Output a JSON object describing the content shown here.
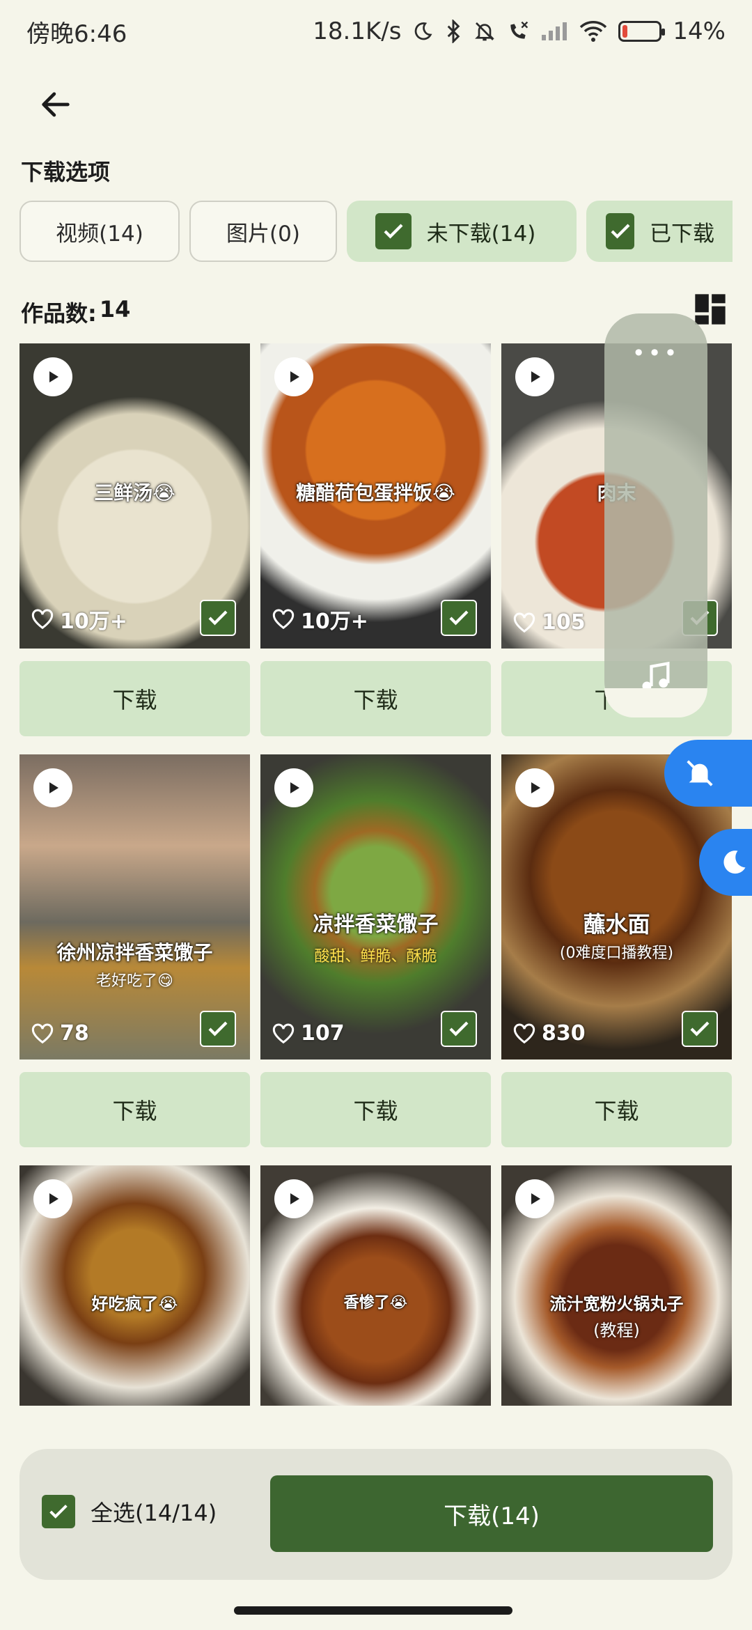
{
  "status": {
    "time": "傍晚6:46",
    "speed": "18.1K/s",
    "battery": "14%",
    "battery_level": 0.14
  },
  "header": {
    "section_title": "下载选项"
  },
  "chips": [
    {
      "label": "视频(14)",
      "checked": false
    },
    {
      "label": "图片(0)",
      "checked": false
    },
    {
      "label": "未下载(14)",
      "checked": true
    },
    {
      "label": "已下载",
      "checked": true
    }
  ],
  "count": {
    "label": "作品数:",
    "value": "14"
  },
  "items": [
    {
      "caption": "三鲜汤😭",
      "subcaption": "",
      "likes": "10万+",
      "download_label": "下载"
    },
    {
      "caption": "糖醋荷包蛋拌饭😭",
      "subcaption": "",
      "likes": "10万+",
      "download_label": "下载"
    },
    {
      "caption": "肉末",
      "subcaption": "",
      "likes": "105",
      "download_label": "下载"
    },
    {
      "caption": "徐州凉拌香菜馓子",
      "subcaption": "老好吃了😋",
      "likes": "78",
      "download_label": "下载"
    },
    {
      "caption": "凉拌香菜馓子",
      "subcaption": "酸甜、鲜脆、酥脆",
      "likes": "107",
      "download_label": "下载"
    },
    {
      "caption": "蘸水面",
      "subcaption": "(0难度口播教程)",
      "likes": "830",
      "download_label": "下载"
    },
    {
      "caption": "好吃疯了😭",
      "subcaption": "",
      "likes": "",
      "download_label": ""
    },
    {
      "caption": "香惨了😭",
      "subcaption": "",
      "likes": "",
      "download_label": ""
    },
    {
      "caption": "流汁宽粉火锅丸子",
      "subcaption": "(教程)",
      "likes": "",
      "download_label": ""
    }
  ],
  "bottom": {
    "select_all_label": "全选(14/14)",
    "download_all_label": "下载(14)"
  },
  "colors": {
    "accent": "#3d6630",
    "chip_filled": "#d2e6c8",
    "bubble": "#2a84f0"
  }
}
